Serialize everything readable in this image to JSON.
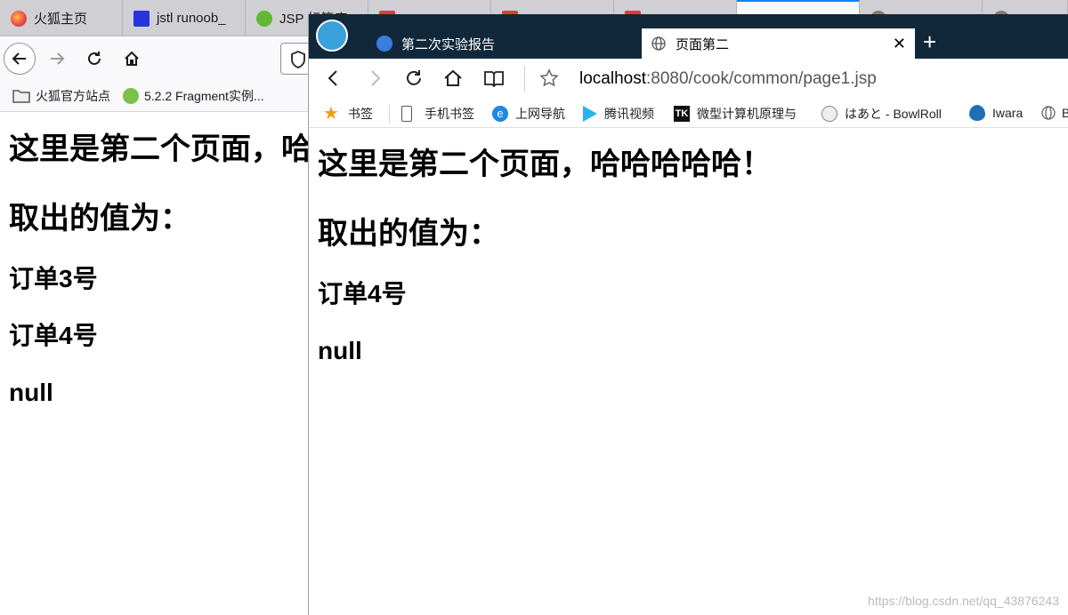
{
  "firefox": {
    "tabs": [
      {
        "label": "火狐主页",
        "active": false
      },
      {
        "label": "jstl runoob_",
        "active": false
      },
      {
        "label": "JSP 标签库",
        "active": false
      },
      {
        "label": "",
        "active": false
      },
      {
        "label": "",
        "active": false
      },
      {
        "label": "",
        "active": false
      },
      {
        "label": "",
        "active": true
      },
      {
        "label": "",
        "active": false
      },
      {
        "label": "",
        "active": false
      }
    ],
    "bookmarks": [
      {
        "label": "火狐官方站点",
        "icon": "folder-icon"
      },
      {
        "label": "5.2.2 Fragment实例...",
        "icon": "vue-icon"
      }
    ],
    "content": {
      "heading1": "这里是第二个页面，哈哈哈哈哈！",
      "heading2": "取出的值为：",
      "items": [
        "订单3号",
        "订单4号",
        "null"
      ]
    }
  },
  "edge": {
    "tabs": [
      {
        "label": "第二次实验报告",
        "active": false
      },
      {
        "label": "页面第二",
        "active": true
      }
    ],
    "url_host": "localhost",
    "url_rest": ":8080/cook/common/page1.jsp",
    "bookmarks": [
      {
        "label": "书签",
        "icon": "star-icon"
      },
      {
        "label": "手机书签",
        "icon": "phone-icon"
      },
      {
        "label": "上网导航",
        "icon": "ie-icon"
      },
      {
        "label": "腾讯视频",
        "icon": "video-icon"
      },
      {
        "label": "微型计算机原理与",
        "icon": "tk-icon"
      },
      {
        "label": "はあと - BowlRoll",
        "icon": "bowlroll-icon"
      },
      {
        "label": "Iwara",
        "icon": "iwara-icon"
      },
      {
        "label": "B",
        "icon": "globe-icon"
      }
    ],
    "content": {
      "heading1": "这里是第二个页面，哈哈哈哈哈！",
      "heading2": "取出的值为：",
      "items": [
        "订单4号",
        "null"
      ]
    }
  },
  "watermark": "https://blog.csdn.net/qq_43876243"
}
